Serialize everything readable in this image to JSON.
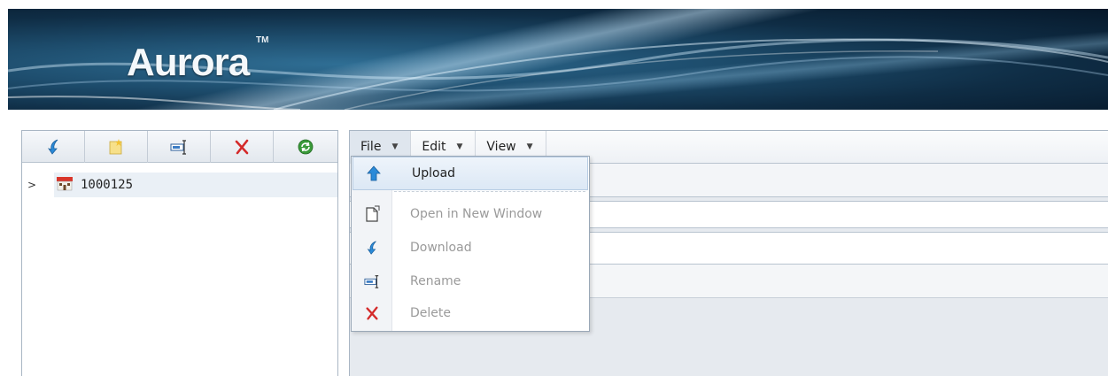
{
  "banner": {
    "logo_text": "Aurora",
    "trademark": "TM"
  },
  "left_toolbar": {
    "buttons": [
      {
        "icon": "download-arrow-icon"
      },
      {
        "icon": "new-folder-icon"
      },
      {
        "icon": "rename-icon"
      },
      {
        "icon": "delete-icon"
      },
      {
        "icon": "refresh-icon"
      }
    ]
  },
  "tree": {
    "nodes": [
      {
        "label": "1000125",
        "expander": ">",
        "icon": "building-icon"
      }
    ]
  },
  "menubar": {
    "items": [
      {
        "label": "File",
        "arrow": "▼"
      },
      {
        "label": "Edit",
        "arrow": "▼"
      },
      {
        "label": "View",
        "arrow": "▼"
      }
    ]
  },
  "file_menu": {
    "items": [
      {
        "label": "Upload",
        "icon": "upload-arrow-icon",
        "enabled": true
      },
      {
        "label": "Open in New Window",
        "icon": "new-window-icon",
        "enabled": false
      },
      {
        "label": "Download",
        "icon": "download-arrow-icon",
        "enabled": false
      },
      {
        "label": "Rename",
        "icon": "rename-icon",
        "enabled": false
      },
      {
        "label": "Delete",
        "icon": "delete-icon",
        "enabled": false
      }
    ]
  },
  "colors": {
    "banner_dark": "#06182a",
    "banner_mid": "#2f6e94",
    "accent_blue": "#2a8ad8",
    "delete_red": "#d42a2a",
    "refresh_green": "#3a9a3a"
  }
}
